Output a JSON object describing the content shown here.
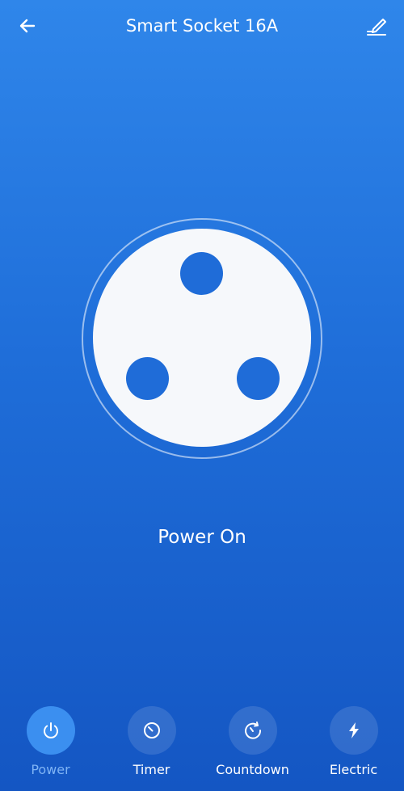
{
  "header": {
    "title": "Smart Socket 16A",
    "back_icon": "back-arrow-icon",
    "edit_icon": "edit-pencil-icon"
  },
  "socket": {
    "status_text": "Power On",
    "is_on": true
  },
  "bottom_bar": {
    "items": [
      {
        "label": "Power",
        "icon": "power-icon",
        "active": true
      },
      {
        "label": "Timer",
        "icon": "timer-icon",
        "active": false
      },
      {
        "label": "Countdown",
        "icon": "countdown-icon",
        "active": false
      },
      {
        "label": "Electric",
        "icon": "lightning-icon",
        "active": false
      }
    ]
  },
  "colors": {
    "background_top": "#2f86ea",
    "background_bottom": "#1456c3",
    "socket_face": "#f6f8fb",
    "socket_pins": "#1f6cd8",
    "active_tab_label": "#7fb4f5"
  }
}
